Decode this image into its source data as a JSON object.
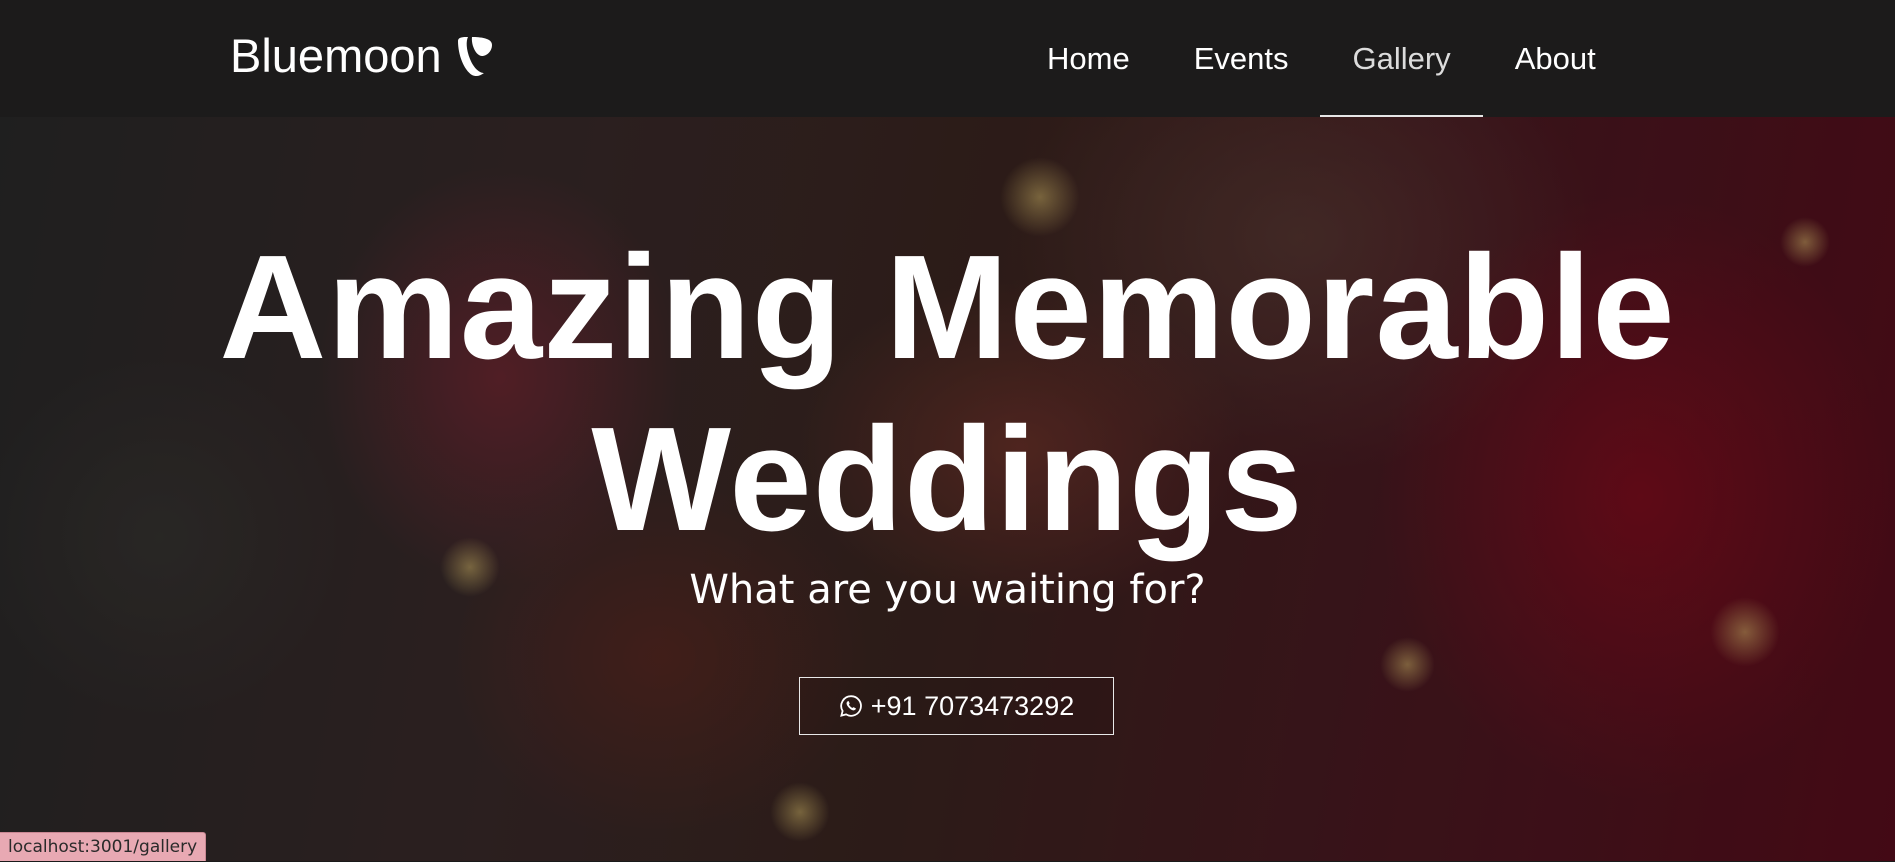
{
  "navbar": {
    "brand": "Bluemoon",
    "brand_icon": "typo3-logo-icon",
    "links": [
      {
        "label": "Home",
        "active": false
      },
      {
        "label": "Events",
        "active": false
      },
      {
        "label": "Gallery",
        "active": true
      },
      {
        "label": "About",
        "active": false
      }
    ]
  },
  "hero": {
    "title": "Amazing Memorable Weddings",
    "subtitle": "What are you waiting for?",
    "cta": {
      "icon": "whatsapp-icon",
      "label": "+91 7073473292"
    }
  },
  "status_bar": {
    "url": "localhost:3001/gallery"
  },
  "colors": {
    "navbar_bg": "#1c1b1b",
    "text": "#ffffff",
    "status_bg": "#e8a9b3"
  }
}
